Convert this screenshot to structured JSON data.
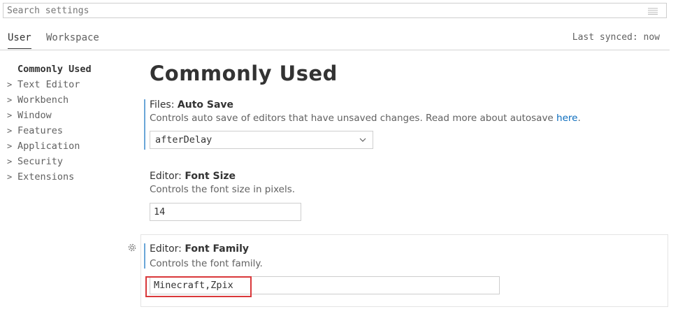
{
  "search": {
    "placeholder": "Search settings",
    "icon": "filter-icon"
  },
  "tabs": [
    {
      "label": "User",
      "active": true
    },
    {
      "label": "Workspace",
      "active": false
    }
  ],
  "sync_status": "Last synced: now",
  "toc": [
    {
      "label": "Commonly Used",
      "active": true,
      "chevron": false
    },
    {
      "label": "Text Editor",
      "chevron": true
    },
    {
      "label": "Workbench",
      "chevron": true
    },
    {
      "label": "Window",
      "chevron": true
    },
    {
      "label": "Features",
      "chevron": true
    },
    {
      "label": "Application",
      "chevron": true
    },
    {
      "label": "Security",
      "chevron": true
    },
    {
      "label": "Extensions",
      "chevron": true
    }
  ],
  "page_title": "Commonly Used",
  "settings": [
    {
      "category": "Files: ",
      "name": "Auto Save",
      "description": "Controls auto save of editors that have unsaved changes. Read more about autosave ",
      "link_text": "here",
      "description_end": ".",
      "value": "afterDelay"
    },
    {
      "category": "Editor: ",
      "name": "Font Size",
      "description": "Controls the font size in pixels.",
      "value": "14"
    },
    {
      "category": "Editor: ",
      "name": "Font Family",
      "description": "Controls the font family.",
      "value": "Minecraft,Zpix"
    }
  ],
  "colors": {
    "accent_bar": "#6aa6d8",
    "link": "#0a6cbd",
    "highlight": "#d9383a"
  }
}
